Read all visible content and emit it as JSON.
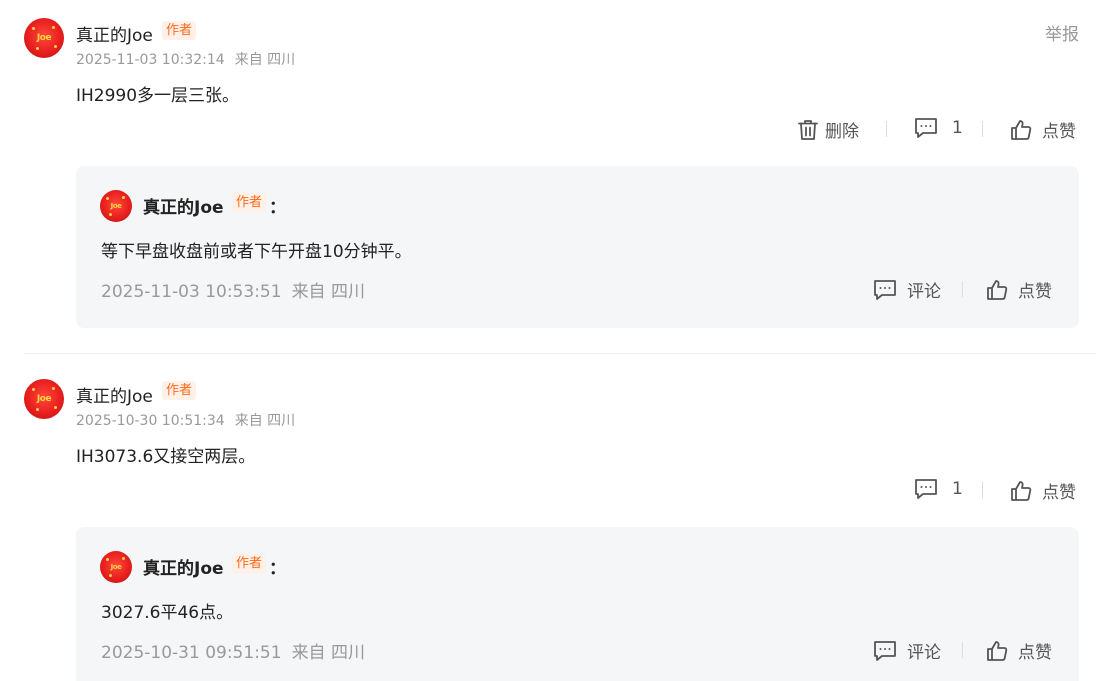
{
  "comments": [
    {
      "author": "真正的Joe",
      "badge": "作者",
      "time": "2025-11-03 10:32:14",
      "location": "来自 四川",
      "report": "举报",
      "content": "IH2990多一层三张。",
      "delete_label": "删除",
      "reply_count": "1",
      "like_label": "点赞",
      "reply": {
        "author": "真正的Joe",
        "badge": "作者",
        "colon": "：",
        "content": "等下早盘收盘前或者下午开盘10分钟平。",
        "time": "2025-11-03 10:53:51",
        "location": "来自 四川",
        "comment_label": "评论",
        "like_label": "点赞"
      }
    },
    {
      "author": "真正的Joe",
      "badge": "作者",
      "time": "2025-10-30 10:51:34",
      "location": "来自 四川",
      "content": "IH3073.6又接空两层。",
      "reply_count": "1",
      "like_label": "点赞",
      "reply": {
        "author": "真正的Joe",
        "badge": "作者",
        "colon": "：",
        "content": "3027.6平46点。",
        "time": "2025-10-31 09:51:51",
        "location": "来自 四川",
        "comment_label": "评论",
        "like_label": "点赞"
      }
    }
  ],
  "avatar_text": "Joe",
  "colors": {
    "badge_bg": "#fff1e8",
    "badge_text": "#ff6a1a",
    "meta": "#999999",
    "reply_bg": "#f5f6f7"
  }
}
